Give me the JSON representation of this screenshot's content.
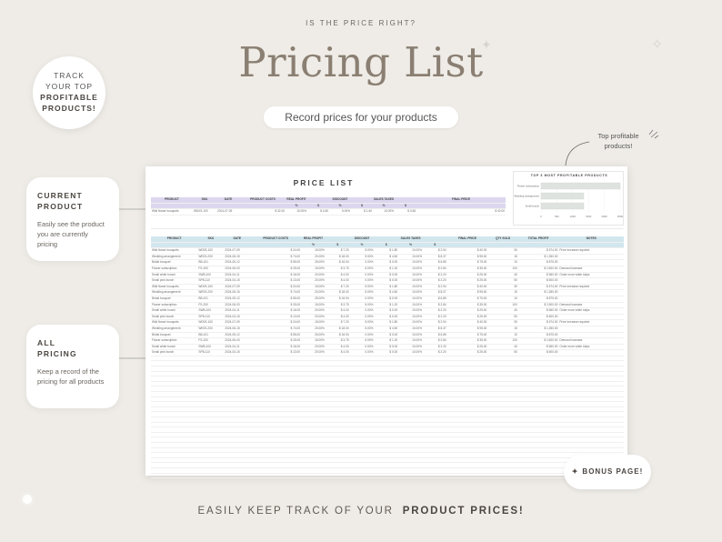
{
  "header": {
    "kicker": "IS THE PRICE RIGHT?",
    "title": "Pricing List",
    "subtitle": "Record prices for your products"
  },
  "badge": {
    "line1": "TRACK",
    "line2": "YOUR TOP",
    "line3": "PROFITABLE",
    "line4": "PRODUCTS!"
  },
  "cards": [
    {
      "title1": "CURRENT",
      "title2": "PRODUCT",
      "desc": "Easily see the product you are currently pricing"
    },
    {
      "title1": "ALL",
      "title2": "PRICING",
      "desc": "Keep a record of the pricing for all products"
    }
  ],
  "top_note": "Top profitable products!",
  "bonus": "BONUS PAGE!",
  "footer": {
    "text": "EASILY KEEP TRACK OF YOUR",
    "bold": "PRODUCT PRICES!"
  },
  "sheet": {
    "title": "PRICE LIST",
    "current_headers": [
      "PRODUCT",
      "SKU",
      "DATE",
      "PRODUCT COSTS",
      "REAL PROFIT",
      "",
      "DISCOUNT",
      "",
      "SALES TAXES",
      "",
      "FINAL PRICE"
    ],
    "current_sub": [
      "",
      "",
      "",
      "",
      "%",
      "$",
      "%",
      "$",
      "%",
      "$",
      ""
    ],
    "current_row": [
      "Wild flower bouquets",
      "WD0S-100",
      "2024-07-09",
      "$",
      "32.00",
      "15.00%",
      "$",
      "4.80",
      "5.00%",
      "$",
      "1.60",
      "10.00%",
      "$",
      "3.68",
      "$",
      "40.00"
    ],
    "list_headers": [
      "PRODUCT",
      "SKU",
      "DATE",
      "PRODUCT COSTS",
      "REAL PROFIT",
      "",
      "DISCOUNT",
      "",
      "SALES TAXES",
      "",
      "FINAL PRICE",
      "QTY SOLD",
      "TOTAL PROFIT",
      "NOTES"
    ],
    "list_sub": [
      "",
      "",
      "",
      "",
      "%",
      "$",
      "%",
      "$",
      "%",
      "$",
      "",
      "",
      "",
      ""
    ],
    "rows": [
      [
        "Wild flower bouquets",
        "WD0S-100",
        "2024-07-09",
        "24.00",
        "15.00%",
        "7.20",
        "5.00%",
        "1.80",
        "10.00%",
        "2.94",
        "40.00",
        "30",
        "574.00",
        "Price increase required"
      ],
      [
        "Wedding arrangement",
        "WE0S-200",
        "2024-06-15",
        "74.00",
        "20.00%",
        "18.00",
        "5.00%",
        "4.50",
        "10.00%",
        "8.37",
        "95.00",
        "15",
        "1,350.00",
        ""
      ],
      [
        "Bridal bouquet",
        "BB-101",
        "2024-05-12",
        "55.00",
        "25.00%",
        "16.94",
        "0.00%",
        "0.00",
        "10.00%",
        "6.85",
        "75.00",
        "10",
        "875.00",
        ""
      ],
      [
        "Flower subscription",
        "FS-200",
        "2024-06-03",
        "25.00",
        "15.00%",
        "3.75",
        "5.00%",
        "1.20",
        "10.00%",
        "2.84",
        "35.00",
        "100",
        "2,500.00",
        "Demand increase"
      ],
      [
        "Small white bunch",
        "SWB-100",
        "2024-04-11",
        "16.00",
        "20.00%",
        "4.00",
        "0.00%",
        "0.00",
        "10.00%",
        "2.20",
        "25.00",
        "40",
        "560.00",
        "Order more white tulips"
      ],
      [
        "Small pink bunch",
        "SPB-110",
        "2024-04-15",
        "13.00",
        "20.00%",
        "4.00",
        "0.00%",
        "0.00",
        "10.00%",
        "2.20",
        "25.00",
        "50",
        "600.00",
        ""
      ],
      [
        "Wild flower bouquets",
        "WD0S-100",
        "2024-07-09",
        "24.00",
        "15.00%",
        "7.20",
        "5.00%",
        "1.80",
        "10.00%",
        "2.94",
        "40.00",
        "30",
        "574.00",
        "Price increase required"
      ],
      [
        "Wedding arrangement",
        "WE0S-200",
        "2024-06-15",
        "74.00",
        "20.00%",
        "18.00",
        "5.00%",
        "4.50",
        "10.00%",
        "8.37",
        "95.00",
        "15",
        "1,350.00",
        ""
      ],
      [
        "Bridal bouquet",
        "BB-101",
        "2024-05-12",
        "55.00",
        "25.00%",
        "16.94",
        "0.00%",
        "0.00",
        "10.00%",
        "6.85",
        "75.00",
        "10",
        "875.00",
        ""
      ],
      [
        "Flower subscription",
        "FS-200",
        "2024-06-03",
        "25.00",
        "15.00%",
        "3.75",
        "5.00%",
        "1.20",
        "10.00%",
        "2.84",
        "35.00",
        "100",
        "2,500.00",
        "Demand increase"
      ],
      [
        "Small white bunch",
        "SWB-100",
        "2024-04-11",
        "16.00",
        "20.00%",
        "4.00",
        "0.00%",
        "0.00",
        "10.00%",
        "2.20",
        "25.00",
        "40",
        "560.00",
        "Order more white tulips"
      ],
      [
        "Small pink bunch",
        "SPB-110",
        "2024-04-15",
        "13.00",
        "20.00%",
        "4.00",
        "0.00%",
        "0.00",
        "10.00%",
        "2.20",
        "25.00",
        "50",
        "600.00",
        ""
      ],
      [
        "Wild flower bouquets",
        "WD0S-100",
        "2024-07-09",
        "24.00",
        "15.00%",
        "7.20",
        "5.00%",
        "1.80",
        "10.00%",
        "2.94",
        "40.00",
        "30",
        "574.00",
        "Price increase required"
      ],
      [
        "Wedding arrangement",
        "WE0S-200",
        "2024-06-15",
        "74.00",
        "20.00%",
        "18.00",
        "5.00%",
        "4.50",
        "10.00%",
        "8.37",
        "95.00",
        "15",
        "1,350.00",
        ""
      ],
      [
        "Bridal bouquet",
        "BB-101",
        "2024-05-12",
        "55.00",
        "25.00%",
        "16.94",
        "0.00%",
        "0.00",
        "10.00%",
        "6.85",
        "75.00",
        "10",
        "875.00",
        ""
      ],
      [
        "Flower subscription",
        "FS-200",
        "2024-06-03",
        "25.00",
        "15.00%",
        "3.75",
        "5.00%",
        "1.20",
        "10.00%",
        "2.84",
        "35.00",
        "100",
        "2,500.00",
        "Demand increase"
      ],
      [
        "Small white bunch",
        "SWB-100",
        "2024-04-11",
        "16.00",
        "20.00%",
        "4.00",
        "0.00%",
        "0.00",
        "10.00%",
        "2.20",
        "25.00",
        "40",
        "560.00",
        "Order more white tulips"
      ],
      [
        "Small pink bunch",
        "SPB-110",
        "2024-04-15",
        "13.00",
        "20.00%",
        "4.00",
        "0.00%",
        "0.00",
        "10.00%",
        "2.20",
        "25.00",
        "50",
        "600.00",
        ""
      ]
    ],
    "blank_rows": 24
  },
  "chart_data": {
    "type": "bar",
    "orientation": "horizontal",
    "title": "TOP 3 MOST PROFITABLE PRODUCTS",
    "categories": [
      "Flower subscription",
      "Wedding arrangement",
      "Small bunch"
    ],
    "values": [
      2500,
      1350,
      1350
    ],
    "xticks": [
      "0",
      "500",
      "1000",
      "1500",
      "2000",
      "2500"
    ],
    "xlim": [
      0,
      2500
    ],
    "color": "#dfe3df",
    "grid": true
  }
}
